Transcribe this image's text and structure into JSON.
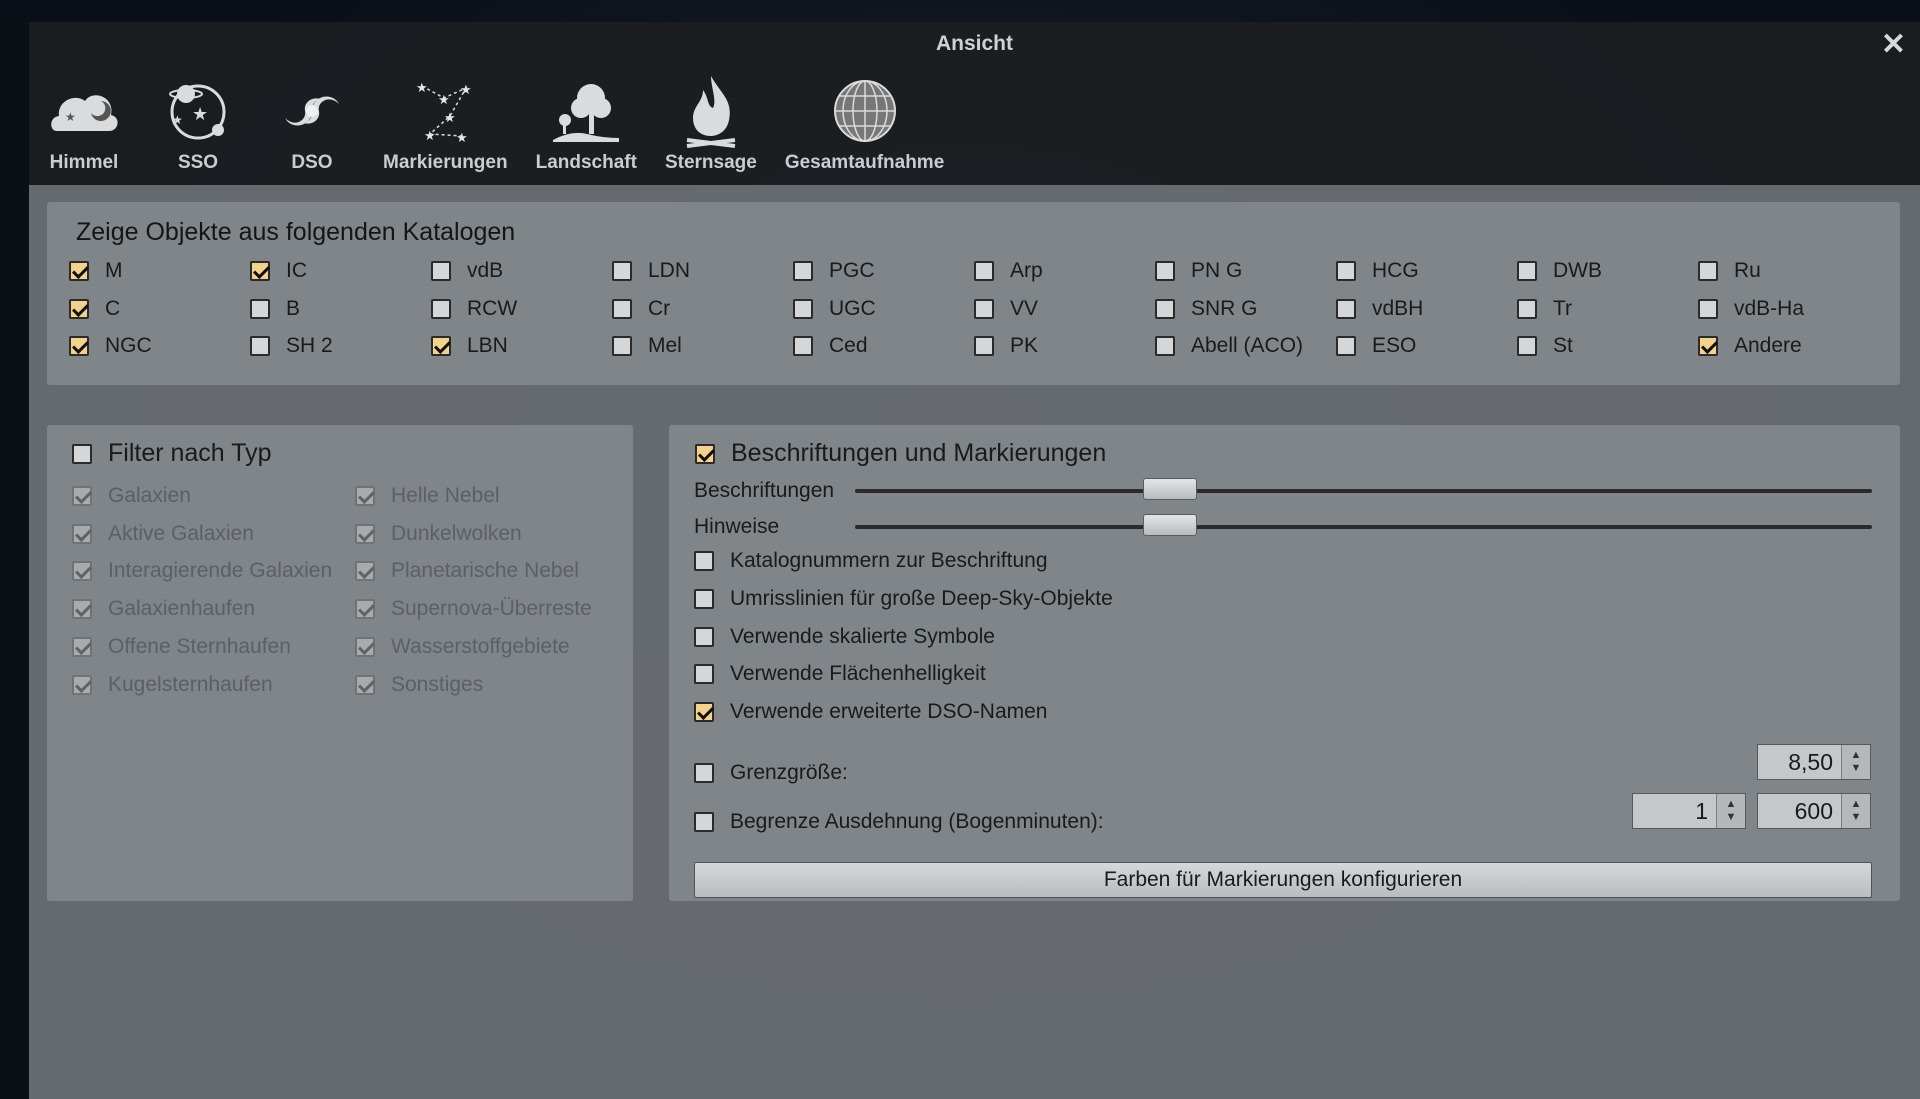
{
  "window": {
    "title": "Ansicht"
  },
  "icons": {
    "close": "close-icon"
  },
  "tabs": [
    {
      "label": "Himmel",
      "icon": "sky-cloud-icon"
    },
    {
      "label": "SSO",
      "icon": "planet-orbit-icon"
    },
    {
      "label": "DSO",
      "icon": "galaxy-icon"
    },
    {
      "label": "Markierungen",
      "icon": "constellation-icon"
    },
    {
      "label": "Landschaft",
      "icon": "landscape-tree-icon"
    },
    {
      "label": "Sternsage",
      "icon": "fire-icon"
    },
    {
      "label": "Gesamtaufnahme",
      "icon": "globe-grid-icon"
    }
  ],
  "catalogs": {
    "title": "Zeige Objekte aus folgenden Katalogen",
    "columns": [
      [
        {
          "label": "M",
          "checked": true
        },
        {
          "label": "C",
          "checked": true
        },
        {
          "label": "NGC",
          "checked": true
        }
      ],
      [
        {
          "label": "IC",
          "checked": true
        },
        {
          "label": "B",
          "checked": false
        },
        {
          "label": "SH 2",
          "checked": false
        }
      ],
      [
        {
          "label": "vdB",
          "checked": false
        },
        {
          "label": "RCW",
          "checked": false
        },
        {
          "label": "LBN",
          "checked": true
        }
      ],
      [
        {
          "label": "LDN",
          "checked": false
        },
        {
          "label": "Cr",
          "checked": false
        },
        {
          "label": "Mel",
          "checked": false
        }
      ],
      [
        {
          "label": "PGC",
          "checked": false
        },
        {
          "label": "UGC",
          "checked": false
        },
        {
          "label": "Ced",
          "checked": false
        }
      ],
      [
        {
          "label": "Arp",
          "checked": false
        },
        {
          "label": "VV",
          "checked": false
        },
        {
          "label": "PK",
          "checked": false
        }
      ],
      [
        {
          "label": "PN G",
          "checked": false
        },
        {
          "label": "SNR G",
          "checked": false
        },
        {
          "label": "Abell (ACO)",
          "checked": false
        }
      ],
      [
        {
          "label": "HCG",
          "checked": false
        },
        {
          "label": "vdBH",
          "checked": false
        },
        {
          "label": "ESO",
          "checked": false
        }
      ],
      [
        {
          "label": "DWB",
          "checked": false
        },
        {
          "label": "Tr",
          "checked": false
        },
        {
          "label": "St",
          "checked": false
        }
      ],
      [
        {
          "label": "Ru",
          "checked": false
        },
        {
          "label": "vdB-Ha",
          "checked": false
        },
        {
          "label": "Andere",
          "checked": true
        }
      ]
    ]
  },
  "filter": {
    "title": "Filter nach Typ",
    "checked": false,
    "columns": [
      [
        {
          "label": "Galaxien",
          "checked": true
        },
        {
          "label": "Aktive Galaxien",
          "checked": true
        },
        {
          "label": "Interagierende Galaxien",
          "checked": true
        },
        {
          "label": "Galaxienhaufen",
          "checked": true
        },
        {
          "label": "Offene Sternhaufen",
          "checked": true
        },
        {
          "label": "Kugelsternhaufen",
          "checked": true
        }
      ],
      [
        {
          "label": "Helle Nebel",
          "checked": true
        },
        {
          "label": "Dunkelwolken",
          "checked": true
        },
        {
          "label": "Planetarische Nebel",
          "checked": true
        },
        {
          "label": "Supernova-Überreste",
          "checked": true
        },
        {
          "label": "Wasserstoffgebiete",
          "checked": true
        },
        {
          "label": "Sonstiges",
          "checked": true
        }
      ]
    ]
  },
  "labels": {
    "title": "Beschriftungen und Markierungen",
    "checked": true,
    "sliders": [
      {
        "label": "Beschriftungen",
        "value": 0.31
      },
      {
        "label": "Hinweise",
        "value": 0.31
      }
    ],
    "options": [
      {
        "label": "Katalognummern zur Beschriftung",
        "checked": false
      },
      {
        "label": "Umrisslinien für große Deep-Sky-Objekte",
        "checked": false
      },
      {
        "label": "Verwende skalierte Symbole",
        "checked": false
      },
      {
        "label": "Verwende Flächenhelligkeit",
        "checked": false
      },
      {
        "label": "Verwende erweiterte DSO-Namen",
        "checked": true
      }
    ],
    "magnitude": {
      "label": "Grenzgröße:",
      "checked": false,
      "value": "8,50"
    },
    "extent": {
      "label": "Begrenze Ausdehnung (Bogenminuten):",
      "checked": false,
      "min": "1",
      "max": "600"
    },
    "colors_button": "Farben für Markierungen konfigurieren"
  }
}
